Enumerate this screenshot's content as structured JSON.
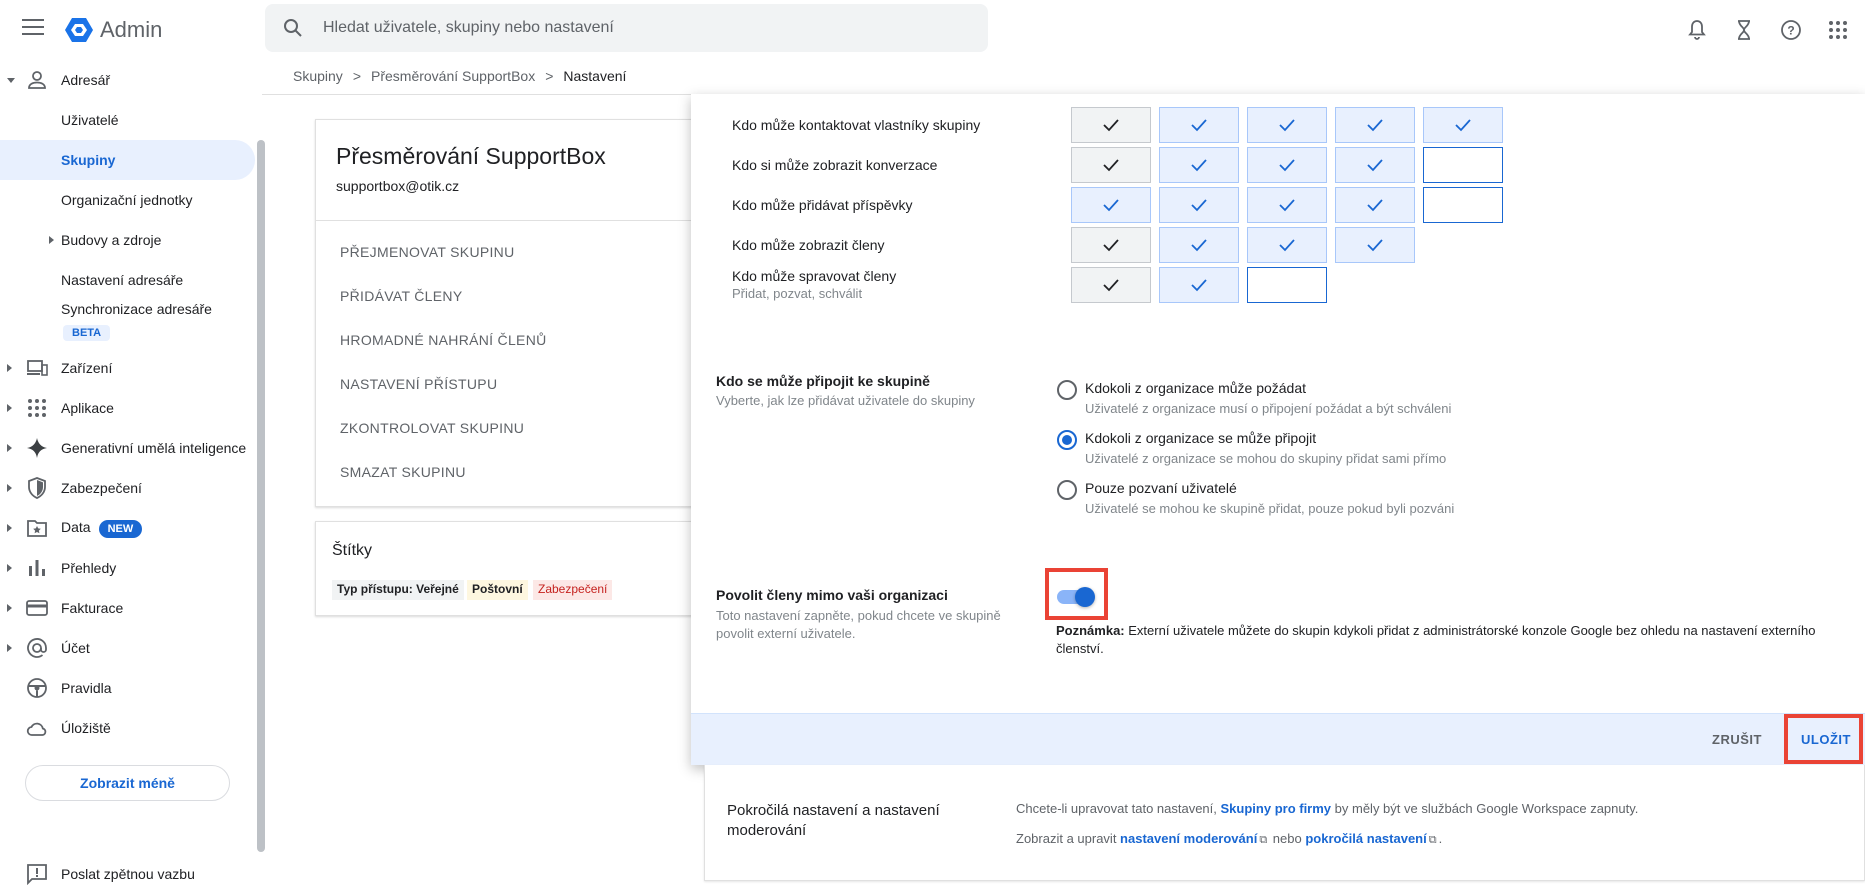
{
  "header": {
    "brand": "Admin",
    "search_placeholder": "Hledat uživatele, skupiny nebo nastavení",
    "colors": {
      "logo": "#1a73e8",
      "accent": "#1967d2"
    }
  },
  "sidebar": {
    "items": [
      {
        "label": "Adresář",
        "icon": "person-icon"
      },
      {
        "label": "Uživatelé"
      },
      {
        "label": "Skupiny"
      },
      {
        "label": "Organizační jednotky"
      },
      {
        "label": "Budovy a zdroje"
      },
      {
        "label": "Nastavení adresáře"
      },
      {
        "label": "Synchronizace adresáře"
      },
      {
        "label": "Zařízení",
        "icon": "devices-icon"
      },
      {
        "label": "Aplikace",
        "icon": "apps-grid-icon"
      },
      {
        "label": "Generativní umělá inteligence",
        "icon": "sparkle-icon"
      },
      {
        "label": "Zabezpečení",
        "icon": "shield-icon"
      },
      {
        "label": "Data",
        "icon": "data-icon"
      },
      {
        "label": "Přehledy",
        "icon": "bar-chart-icon"
      },
      {
        "label": "Fakturace",
        "icon": "credit-card-icon"
      },
      {
        "label": "Účet",
        "icon": "at-sign-icon"
      },
      {
        "label": "Pravidla",
        "icon": "steering-icon"
      },
      {
        "label": "Úložiště",
        "icon": "cloud-icon"
      }
    ],
    "beta_badge": "BETA",
    "new_badge": "NEW",
    "show_less": "Zobrazit méně",
    "feedback": "Poslat zpětnou vazbu"
  },
  "breadcrumb": {
    "items": [
      "Skupiny",
      "Přesměrování SupportBox",
      "Nastavení"
    ],
    "separator": ">"
  },
  "group": {
    "title": "Přesměrování SupportBox",
    "email": "supportbox@otik.cz",
    "actions": [
      "PŘEJMENOVAT SKUPINU",
      "PŘIDÁVAT ČLENY",
      "HROMADNÉ NAHRÁNÍ ČLENŮ",
      "NASTAVENÍ PŘÍSTUPU",
      "ZKONTROLOVAT SKUPINU",
      "SMAZAT SKUPINU"
    ],
    "tags_title": "Štítky",
    "tags": [
      {
        "label": "Typ přístupu: Veřejné",
        "bg": "#f1f3f4"
      },
      {
        "label": "Poštovní",
        "bg": "#fef7e0"
      },
      {
        "label": "Zabezpečení",
        "bg": "#fce8e6"
      }
    ]
  },
  "permissions": {
    "rows": [
      {
        "label": "Kdo může kontaktovat vlastníky skupiny",
        "cells": [
          "check-gray",
          "check-blue",
          "check-blue",
          "check-blue",
          "check-blue"
        ]
      },
      {
        "label": "Kdo si může zobrazit konverzace",
        "cells": [
          "check-gray",
          "check-blue",
          "check-blue",
          "check-blue",
          "empty"
        ]
      },
      {
        "label": "Kdo může přidávat příspěvky",
        "cells": [
          "check-blue",
          "check-blue",
          "check-blue",
          "check-blue",
          "empty"
        ]
      },
      {
        "label": "Kdo může zobrazit členy",
        "cells": [
          "check-gray",
          "check-blue",
          "check-blue",
          "check-blue"
        ]
      },
      {
        "label": "Kdo může spravovat členy",
        "sub": "Přidat, pozvat, schválit",
        "cells": [
          "check-gray",
          "check-blue",
          "empty"
        ]
      }
    ]
  },
  "join": {
    "title": "Kdo se může připojit ke skupině",
    "desc": "Vyberte, jak lze přidávat uživatele do skupiny",
    "options": [
      {
        "title": "Kdokoli z organizace může požádat",
        "desc": "Uživatelé z organizace musí o připojení požádat a být schváleni",
        "selected": false
      },
      {
        "title": "Kdokoli z organizace se může připojit",
        "desc": "Uživatelé z organizace se mohou do skupiny přidat sami přímo",
        "selected": true
      },
      {
        "title": "Pouze pozvaní uživatelé",
        "desc": "Uživatelé se mohou ke skupině přidat, pouze pokud byli pozváni",
        "selected": false
      }
    ]
  },
  "external": {
    "title": "Povolit členy mimo vaši organizaci",
    "desc_line1": "Toto nastavení zapněte, pokud chcete ve skupině",
    "desc_line2": "povolit externí uživatele.",
    "toggle_on": true,
    "note_label": "Poznámka:",
    "note_text": " Externí uživatele můžete do skupin kdykoli přidat z administrátorské konzole Google bez ohledu na nastavení externího členství."
  },
  "footer": {
    "cancel": "ZRUŠIT",
    "save": "ULOŽIT"
  },
  "advanced": {
    "title": "Pokročilá nastavení a nastavení moderování",
    "line1_pre": "Chcete-li upravovat tato nastavení, ",
    "line1_link": "Skupiny pro firmy",
    "line1_post": " by měly být ve službách Google Workspace zapnuty.",
    "line2_pre": "Zobrazit a upravit ",
    "line2_link1": "nastavení moderování",
    "line2_mid": " nebo ",
    "line2_link2": "pokročilá nastavení",
    "line2_post": "."
  }
}
